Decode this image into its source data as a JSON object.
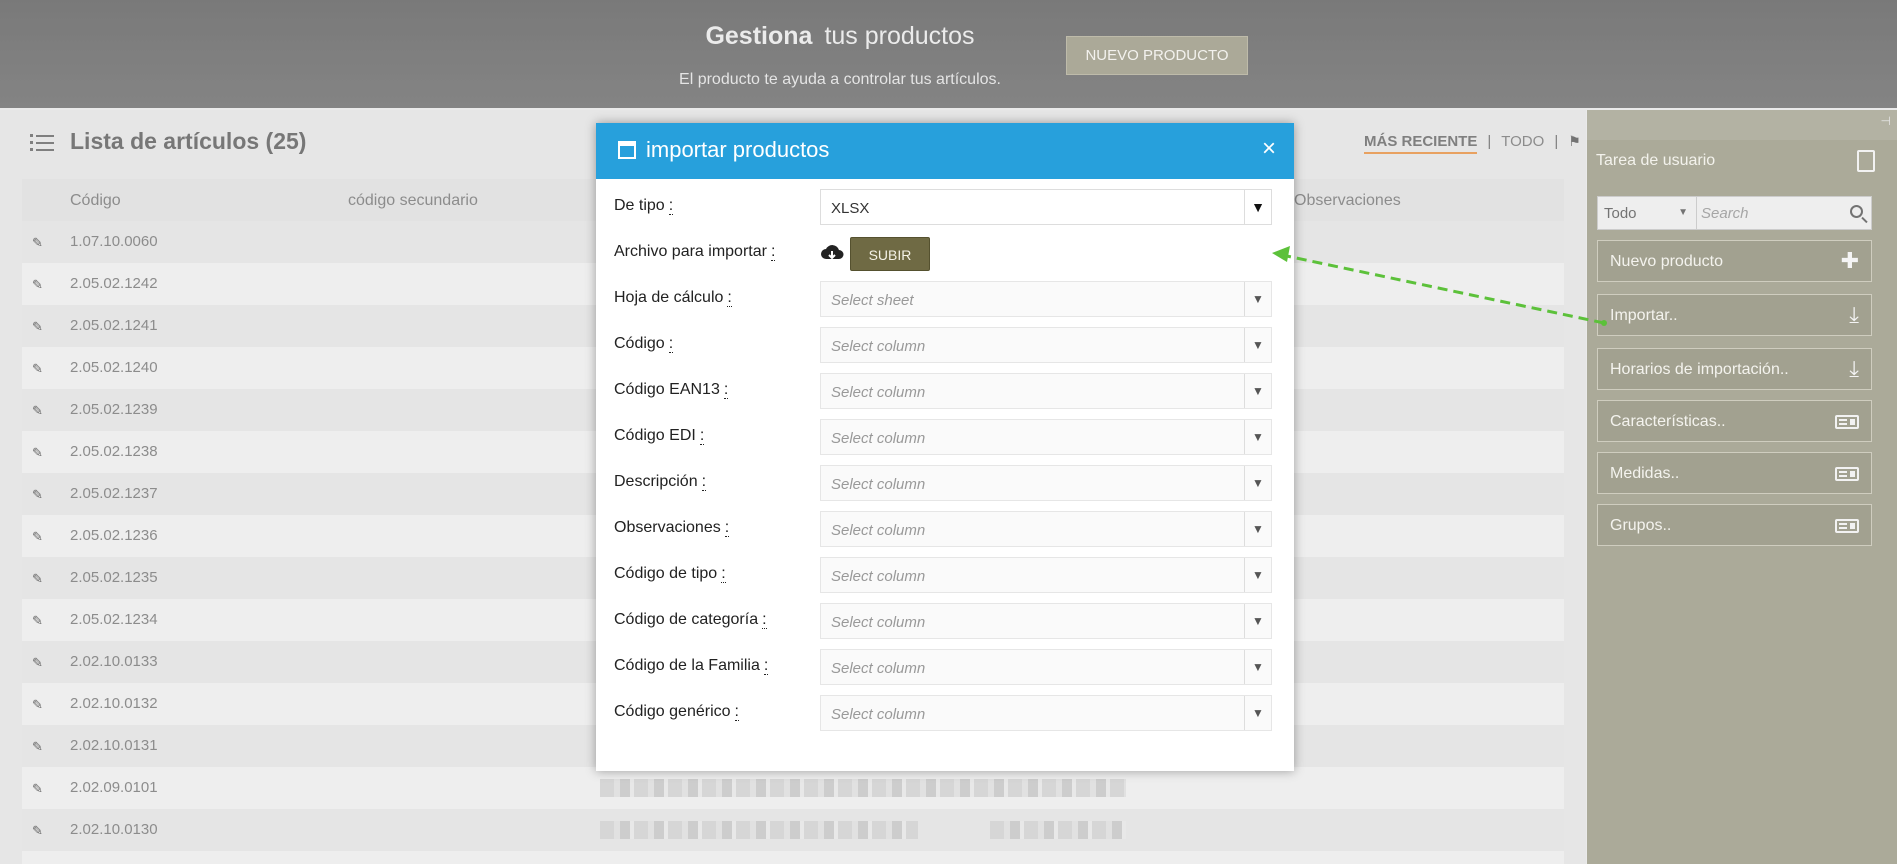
{
  "header": {
    "title_bold": "Gestiona",
    "title_rest": "tus productos",
    "subtitle": "El producto te ayuda a controlar tus artículos.",
    "new_button": "NUEVO PRODUCTO"
  },
  "list": {
    "title": "Lista de artículos (25)",
    "filter_recent": "MÁS RECIENTE",
    "filter_all": "TODO",
    "separator": "|",
    "columns": [
      "Código",
      "código secundario",
      "Observaciones"
    ],
    "rows": [
      "1.07.10.0060",
      "2.05.02.1242",
      "2.05.02.1241",
      "2.05.02.1240",
      "2.05.02.1239",
      "2.05.02.1238",
      "2.05.02.1237",
      "2.05.02.1236",
      "2.05.02.1235",
      "2.05.02.1234",
      "2.02.10.0133",
      "2.02.10.0132",
      "2.02.10.0131",
      "2.02.09.0101",
      "2.02.10.0130"
    ]
  },
  "sidebar": {
    "task_title": "Tarea de usuario",
    "filter_value": "Todo",
    "search_placeholder": "Search",
    "buttons": [
      {
        "label": "Nuevo producto",
        "icon": "plus-icon"
      },
      {
        "label": "Importar..",
        "icon": "download-icon"
      },
      {
        "label": "Horarios de importación..",
        "icon": "download-icon"
      },
      {
        "label": "Características..",
        "icon": "card-icon"
      },
      {
        "label": "Medidas..",
        "icon": "card-icon"
      },
      {
        "label": "Grupos..",
        "icon": "card-icon"
      }
    ]
  },
  "modal": {
    "title": "importar productos",
    "close": "×",
    "upload_button": "SUBIR",
    "fields": [
      {
        "label": "De tipo",
        "value": "XLSX"
      },
      {
        "label": "Archivo para importar"
      },
      {
        "label": "Hoja de cálculo",
        "placeholder": "Select sheet"
      },
      {
        "label": "Código",
        "placeholder": "Select column"
      },
      {
        "label": "Código EAN13",
        "placeholder": "Select column"
      },
      {
        "label": "Código EDI",
        "placeholder": "Select column"
      },
      {
        "label": "Descripción",
        "placeholder": "Select column"
      },
      {
        "label": "Observaciones",
        "placeholder": "Select column"
      },
      {
        "label": "Código de tipo",
        "placeholder": "Select column"
      },
      {
        "label": "Código de categoría",
        "placeholder": "Select column"
      },
      {
        "label": "Código de la Familia",
        "placeholder": "Select column"
      },
      {
        "label": "Código genérico",
        "placeholder": "Select column"
      }
    ]
  },
  "colors": {
    "modal_header": "#27a0dc",
    "sidebar": "#8f8e77",
    "upload_button": "#6f6a44",
    "annotation_arrow": "#5cc13a"
  }
}
